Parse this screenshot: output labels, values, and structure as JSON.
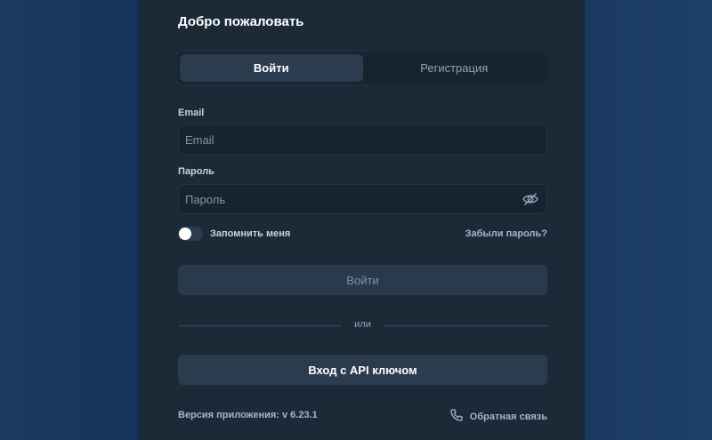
{
  "header": {
    "title": "Добро пожаловать"
  },
  "tabs": [
    {
      "label": "Войти",
      "active": true
    },
    {
      "label": "Регистрация",
      "active": false
    }
  ],
  "form": {
    "email_label": "Email",
    "email_placeholder": "Email",
    "email_value": "",
    "password_label": "Пароль",
    "password_placeholder": "Пароль",
    "password_value": "",
    "password_icon": "eye-off-icon",
    "remember_label": "Запомнить меня",
    "remember_checked": false,
    "forgot_label": "Забыли пароль?",
    "submit_label": "Войти"
  },
  "divider": {
    "label": "или"
  },
  "api_button": {
    "label": "Вход с API ключом"
  },
  "footer": {
    "version": "Версия приложения: v 6.23.1",
    "feedback_label": "Обратная связь",
    "feedback_icon": "phone-icon"
  },
  "colors": {
    "panel_bg": "#1c2a38",
    "accent_link": "#9fb7cf",
    "button_bg": "#2c3c4f"
  }
}
